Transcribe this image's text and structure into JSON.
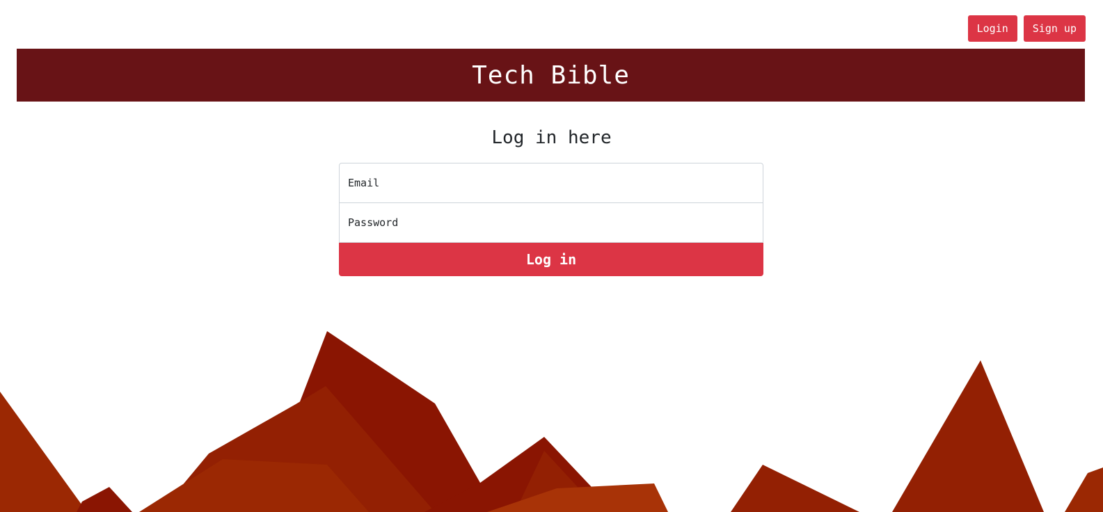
{
  "nav": {
    "login_label": "Login",
    "signup_label": "Sign up"
  },
  "banner": {
    "title": "Tech Bible"
  },
  "login": {
    "heading": "Log in here",
    "email_placeholder": "Email",
    "password_placeholder": "Password",
    "submit_label": "Log in"
  },
  "colors": {
    "banner_bg": "#681316",
    "button_bg": "#dc3545",
    "mountain_dark": "#8a1502",
    "mountain_mid": "#932003",
    "mountain_light": "#9b2803",
    "mountain_orange": "#a83307"
  }
}
